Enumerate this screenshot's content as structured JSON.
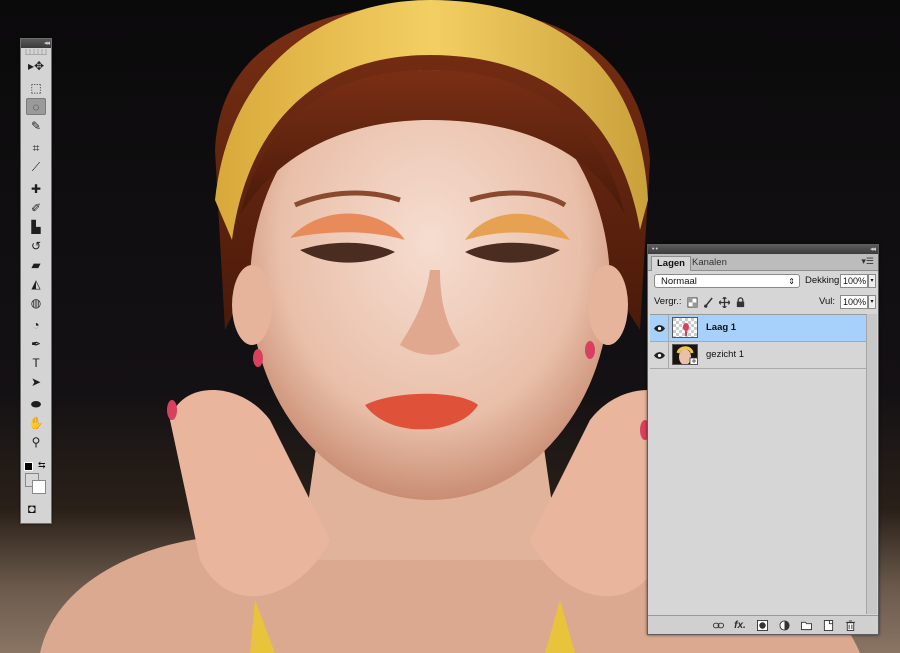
{
  "tools_panel": {
    "titlebar_glyph": "◂◂",
    "tools": [
      {
        "name": "move-tool-icon",
        "glyph": "▸✥"
      },
      {
        "name": "marquee-tool-icon",
        "glyph": "⬚"
      },
      {
        "name": "lasso-tool-icon",
        "glyph": "◌",
        "active": true
      },
      {
        "name": "quick-select-tool-icon",
        "glyph": "✎"
      },
      {
        "name": "crop-tool-icon",
        "glyph": "⌗"
      },
      {
        "name": "eyedropper-tool-icon",
        "glyph": "⟋"
      },
      {
        "name": "healing-brush-tool-icon",
        "glyph": "✚"
      },
      {
        "name": "brush-tool-icon",
        "glyph": "✐"
      },
      {
        "name": "clone-stamp-tool-icon",
        "glyph": "▙"
      },
      {
        "name": "history-brush-tool-icon",
        "glyph": "↺"
      },
      {
        "name": "eraser-tool-icon",
        "glyph": "▰"
      },
      {
        "name": "paint-bucket-tool-icon",
        "glyph": "◭"
      },
      {
        "name": "dodge-tool-icon",
        "glyph": "◍"
      },
      {
        "name": "blur-tool-icon",
        "glyph": "◔"
      },
      {
        "name": "pen-tool-icon",
        "glyph": "✒"
      },
      {
        "name": "type-tool-icon",
        "glyph": "T"
      },
      {
        "name": "path-select-tool-icon",
        "glyph": "➤"
      },
      {
        "name": "ellipse-tool-icon",
        "glyph": "⬬"
      },
      {
        "name": "hand-tool-icon",
        "glyph": "✋"
      },
      {
        "name": "zoom-tool-icon",
        "glyph": "⚲"
      }
    ],
    "foreground_color": "#000000",
    "background_color": "#ffffff",
    "swatch_light": "#d8d8d8",
    "quick_mask_glyph": "◘"
  },
  "layers_panel": {
    "titlebar_glyph": "◂◂",
    "tabs": [
      "Lagen",
      "Kanalen"
    ],
    "active_tab": "Lagen",
    "menu_glyph": "▾☰",
    "blend_mode": "Normaal",
    "blend_arrow": "⇕",
    "opacity_label": "Dekking:",
    "opacity_value": "100%",
    "lock_label": "Vergr.:",
    "fill_label": "Vul:",
    "fill_value": "100%",
    "spinner_glyph": "▾",
    "layers": [
      {
        "name": "Laag 1",
        "selected": true,
        "visible": true
      },
      {
        "name": "gezicht 1",
        "selected": false,
        "visible": true
      }
    ],
    "footer_icons": [
      "link-layers-icon",
      "fx-icon",
      "layer-mask-icon",
      "adjustment-layer-icon",
      "new-group-icon",
      "new-layer-icon",
      "trash-icon"
    ],
    "fx_glyph": "fx.",
    "colors": {
      "selection": "#a7d0fa",
      "panel": "#d6d6d6"
    }
  }
}
